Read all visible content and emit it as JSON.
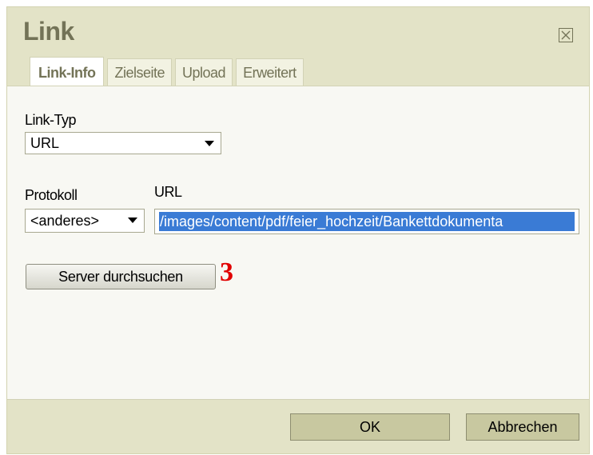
{
  "dialog": {
    "title": "Link",
    "close_icon": "close-icon"
  },
  "tabs": [
    {
      "label": "Link-Info",
      "active": true
    },
    {
      "label": "Zielseite",
      "active": false
    },
    {
      "label": "Upload",
      "active": false
    },
    {
      "label": "Erweitert",
      "active": false
    }
  ],
  "form": {
    "link_type_label": "Link-Typ",
    "link_type_value": "URL",
    "protocol_label": "Protokoll",
    "protocol_value": "<anderes>",
    "url_label": "URL",
    "url_value": "/images/content/pdf/feier_hochzeit/Bankettdokumenta",
    "browse_button": "Server durchsuchen",
    "annotation": "3"
  },
  "footer": {
    "ok_label": "OK",
    "cancel_label": "Abbrechen"
  },
  "colors": {
    "dialog_bg": "#e3e3c7",
    "title": "#737357",
    "selection": "#3a7bd5",
    "annotation": "#e10000"
  }
}
